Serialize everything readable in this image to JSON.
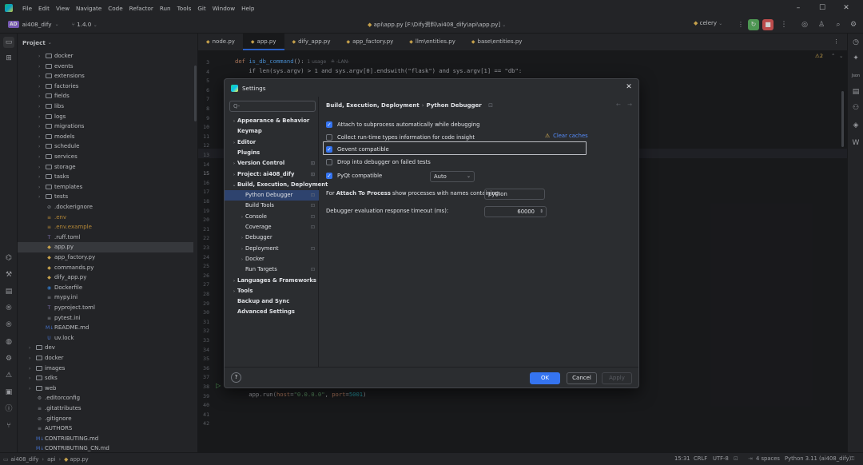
{
  "menubar": {
    "items": [
      "File",
      "Edit",
      "View",
      "Navigate",
      "Code",
      "Refactor",
      "Run",
      "Tools",
      "Git",
      "Window",
      "Help"
    ]
  },
  "toolbar": {
    "project_badge": "AD",
    "project_name": "ai408_dify",
    "vcs_label": "1.4.0",
    "center_title": "api\\app.py [F:\\Dify资料\\ai408_dify\\api\\app.py]",
    "run_config": "celery"
  },
  "project_panel": {
    "title": "Project",
    "tree": [
      {
        "name": "docker",
        "type": "folder",
        "depth": 2,
        "expandable": true
      },
      {
        "name": "events",
        "type": "folder",
        "depth": 2,
        "expandable": true
      },
      {
        "name": "extensions",
        "type": "folder",
        "depth": 2,
        "expandable": true
      },
      {
        "name": "factories",
        "type": "folder",
        "depth": 2,
        "expandable": true
      },
      {
        "name": "fields",
        "type": "folder",
        "depth": 2,
        "expandable": true
      },
      {
        "name": "libs",
        "type": "folder",
        "depth": 2,
        "expandable": true
      },
      {
        "name": "logs",
        "type": "folder",
        "depth": 2,
        "expandable": true
      },
      {
        "name": "migrations",
        "type": "folder",
        "depth": 2,
        "expandable": true
      },
      {
        "name": "models",
        "type": "folder",
        "depth": 2,
        "expandable": true
      },
      {
        "name": "schedule",
        "type": "folder",
        "depth": 2,
        "expandable": true
      },
      {
        "name": "services",
        "type": "folder",
        "depth": 2,
        "expandable": true
      },
      {
        "name": "storage",
        "type": "folder",
        "depth": 2,
        "expandable": true
      },
      {
        "name": "tasks",
        "type": "folder",
        "depth": 2,
        "expandable": true
      },
      {
        "name": "templates",
        "type": "folder",
        "depth": 2,
        "expandable": true
      },
      {
        "name": "tests",
        "type": "folder",
        "depth": 2,
        "expandable": true
      },
      {
        "name": ".dockerignore",
        "type": "ignore",
        "depth": 2,
        "expandable": false
      },
      {
        "name": ".env",
        "type": "env",
        "depth": 2,
        "expandable": false
      },
      {
        "name": ".env.example",
        "type": "env",
        "depth": 2,
        "expandable": false
      },
      {
        "name": ".ruff.toml",
        "type": "toml",
        "depth": 2,
        "expandable": false
      },
      {
        "name": "app.py",
        "type": "python",
        "depth": 2,
        "expandable": false,
        "selected": true
      },
      {
        "name": "app_factory.py",
        "type": "python",
        "depth": 2,
        "expandable": false
      },
      {
        "name": "commands.py",
        "type": "python",
        "depth": 2,
        "expandable": false
      },
      {
        "name": "dify_app.py",
        "type": "python",
        "depth": 2,
        "expandable": false
      },
      {
        "name": "Dockerfile",
        "type": "docker",
        "depth": 2,
        "expandable": false
      },
      {
        "name": "mypy.ini",
        "type": "ini",
        "depth": 2,
        "expandable": false
      },
      {
        "name": "pyproject.toml",
        "type": "toml",
        "depth": 2,
        "expandable": false
      },
      {
        "name": "pytest.ini",
        "type": "ini",
        "depth": 2,
        "expandable": false
      },
      {
        "name": "README.md",
        "type": "md",
        "depth": 2,
        "expandable": false
      },
      {
        "name": "uv.lock",
        "type": "lock",
        "depth": 2,
        "expandable": false
      },
      {
        "name": "dev",
        "type": "folder",
        "depth": 1,
        "expandable": true
      },
      {
        "name": "docker",
        "type": "folder",
        "depth": 1,
        "expandable": true
      },
      {
        "name": "images",
        "type": "folder",
        "depth": 1,
        "expandable": true
      },
      {
        "name": "sdks",
        "type": "folder",
        "depth": 1,
        "expandable": true
      },
      {
        "name": "web",
        "type": "folder",
        "depth": 1,
        "expandable": true
      },
      {
        "name": ".editorconfig",
        "type": "gear",
        "depth": 1,
        "expandable": false
      },
      {
        "name": ".gitattributes",
        "type": "ini",
        "depth": 1,
        "expandable": false
      },
      {
        "name": ".gitignore",
        "type": "ignore",
        "depth": 1,
        "expandable": false
      },
      {
        "name": "AUTHORS",
        "type": "text",
        "depth": 1,
        "expandable": false
      },
      {
        "name": "CONTRIBUTING.md",
        "type": "md",
        "depth": 1,
        "expandable": false
      },
      {
        "name": "CONTRIBUTING_CN.md",
        "type": "md",
        "depth": 1,
        "expandable": false
      }
    ]
  },
  "editor": {
    "tabs": [
      {
        "label": "node.py",
        "active": false
      },
      {
        "label": "app.py",
        "active": true
      },
      {
        "label": "dify_app.py",
        "active": false
      },
      {
        "label": "app_factory.py",
        "active": false
      },
      {
        "label": "llm\\entities.py",
        "active": false
      },
      {
        "label": "base\\entities.py",
        "active": false
      }
    ],
    "line_numbers": [
      "3",
      "4",
      "5",
      "6",
      "7",
      "8",
      "9",
      "10",
      "11",
      "12",
      "13",
      "14",
      "15",
      "16",
      "17",
      "18",
      "19",
      "20",
      "21",
      "22",
      "23",
      "24",
      "25",
      "26",
      "27",
      "28",
      "29",
      "30",
      "31",
      "32",
      "33",
      "34",
      "35",
      "36",
      "37",
      "38",
      "39",
      "40",
      "41",
      "42"
    ],
    "code": {
      "l4_def": "def ",
      "l4_fn": "is_db_command",
      "l4_rest": "():",
      "l4_hint": "  1 usage   ≗ -LAN-",
      "l5": "    if len(sys.argv) > 1 and sys.argv[0].endswith(\"flask\") and sys.argv[1] == \"db\":",
      "l41_pre": "    app.run(",
      "l41_host_kw": "host",
      "l41_host_val": "\"0.0.0.0\"",
      "l41_port_kw": "port",
      "l41_port_val": "5001",
      "l41_post": ")"
    },
    "warnings_badge": "⚠2"
  },
  "settings_dialog": {
    "title": "Settings",
    "search_placeholder": "Q-",
    "nav": [
      {
        "label": "Appearance & Behavior",
        "level": 0,
        "arrow": true,
        "bold": true
      },
      {
        "label": "Keymap",
        "level": 0,
        "arrow": false,
        "bold": true
      },
      {
        "label": "Editor",
        "level": 0,
        "arrow": true,
        "bold": true
      },
      {
        "label": "Plugins",
        "level": 0,
        "arrow": false,
        "bold": true
      },
      {
        "label": "Version Control",
        "level": 0,
        "arrow": true,
        "bold": true,
        "pin": true
      },
      {
        "label": "Project: ai408_dify",
        "level": 0,
        "arrow": true,
        "bold": true,
        "pin": true
      },
      {
        "label": "Build, Execution, Deployment",
        "level": 0,
        "arrow": "open",
        "bold": true
      },
      {
        "label": "Python Debugger",
        "level": 1,
        "arrow": false,
        "selected": true,
        "pin": true
      },
      {
        "label": "Build Tools",
        "level": 1,
        "arrow": false,
        "pin": true
      },
      {
        "label": "Console",
        "level": 1,
        "arrow": true,
        "pin": true
      },
      {
        "label": "Coverage",
        "level": 1,
        "arrow": false,
        "pin": true
      },
      {
        "label": "Debugger",
        "level": 1,
        "arrow": true
      },
      {
        "label": "Deployment",
        "level": 1,
        "arrow": true,
        "pin": true
      },
      {
        "label": "Docker",
        "level": 1,
        "arrow": true
      },
      {
        "label": "Run Targets",
        "level": 1,
        "arrow": false,
        "pin": true
      },
      {
        "label": "Languages & Frameworks",
        "level": 0,
        "arrow": true,
        "bold": true
      },
      {
        "label": "Tools",
        "level": 0,
        "arrow": true,
        "bold": true
      },
      {
        "label": "Backup and Sync",
        "level": 0,
        "arrow": false,
        "bold": true
      },
      {
        "label": "Advanced Settings",
        "level": 0,
        "arrow": false,
        "bold": true
      }
    ],
    "breadcrumb": {
      "parent": "Build, Execution, Deployment",
      "current": "Python Debugger"
    },
    "options": [
      {
        "label": "Attach to subprocess automatically while debugging",
        "checked": true
      },
      {
        "label": "Collect run-time types information for code insight",
        "checked": false
      },
      {
        "label": "Gevent compatible",
        "checked": true
      },
      {
        "label": "Drop into debugger on failed tests",
        "checked": false
      },
      {
        "label": "PyQt compatible",
        "checked": true
      }
    ],
    "clear_caches": "Clear caches",
    "pyqt_select_value": "Auto",
    "attach_label_prefix": "For ",
    "attach_label_bold": "Attach To Process",
    "attach_label_suffix": " show processes with names containing:",
    "attach_value": "python",
    "timeout_label": "Debugger evaluation response timeout (ms):",
    "timeout_value": "60000",
    "help": "?",
    "ok": "OK",
    "cancel": "Cancel",
    "apply": "Apply"
  },
  "statusbar": {
    "path": [
      "ai408_dify",
      "api",
      "app.py"
    ],
    "position": "15:31",
    "line_ending": "CRLF",
    "encoding": "UTF-8",
    "indent": "4 spaces",
    "interpreter": "Python 3.11 (ai408_dify)"
  },
  "colors": {
    "accent": "#3574f0",
    "background": "#1e1f22",
    "panel": "#2b2d30",
    "warning": "#f2c55c"
  }
}
